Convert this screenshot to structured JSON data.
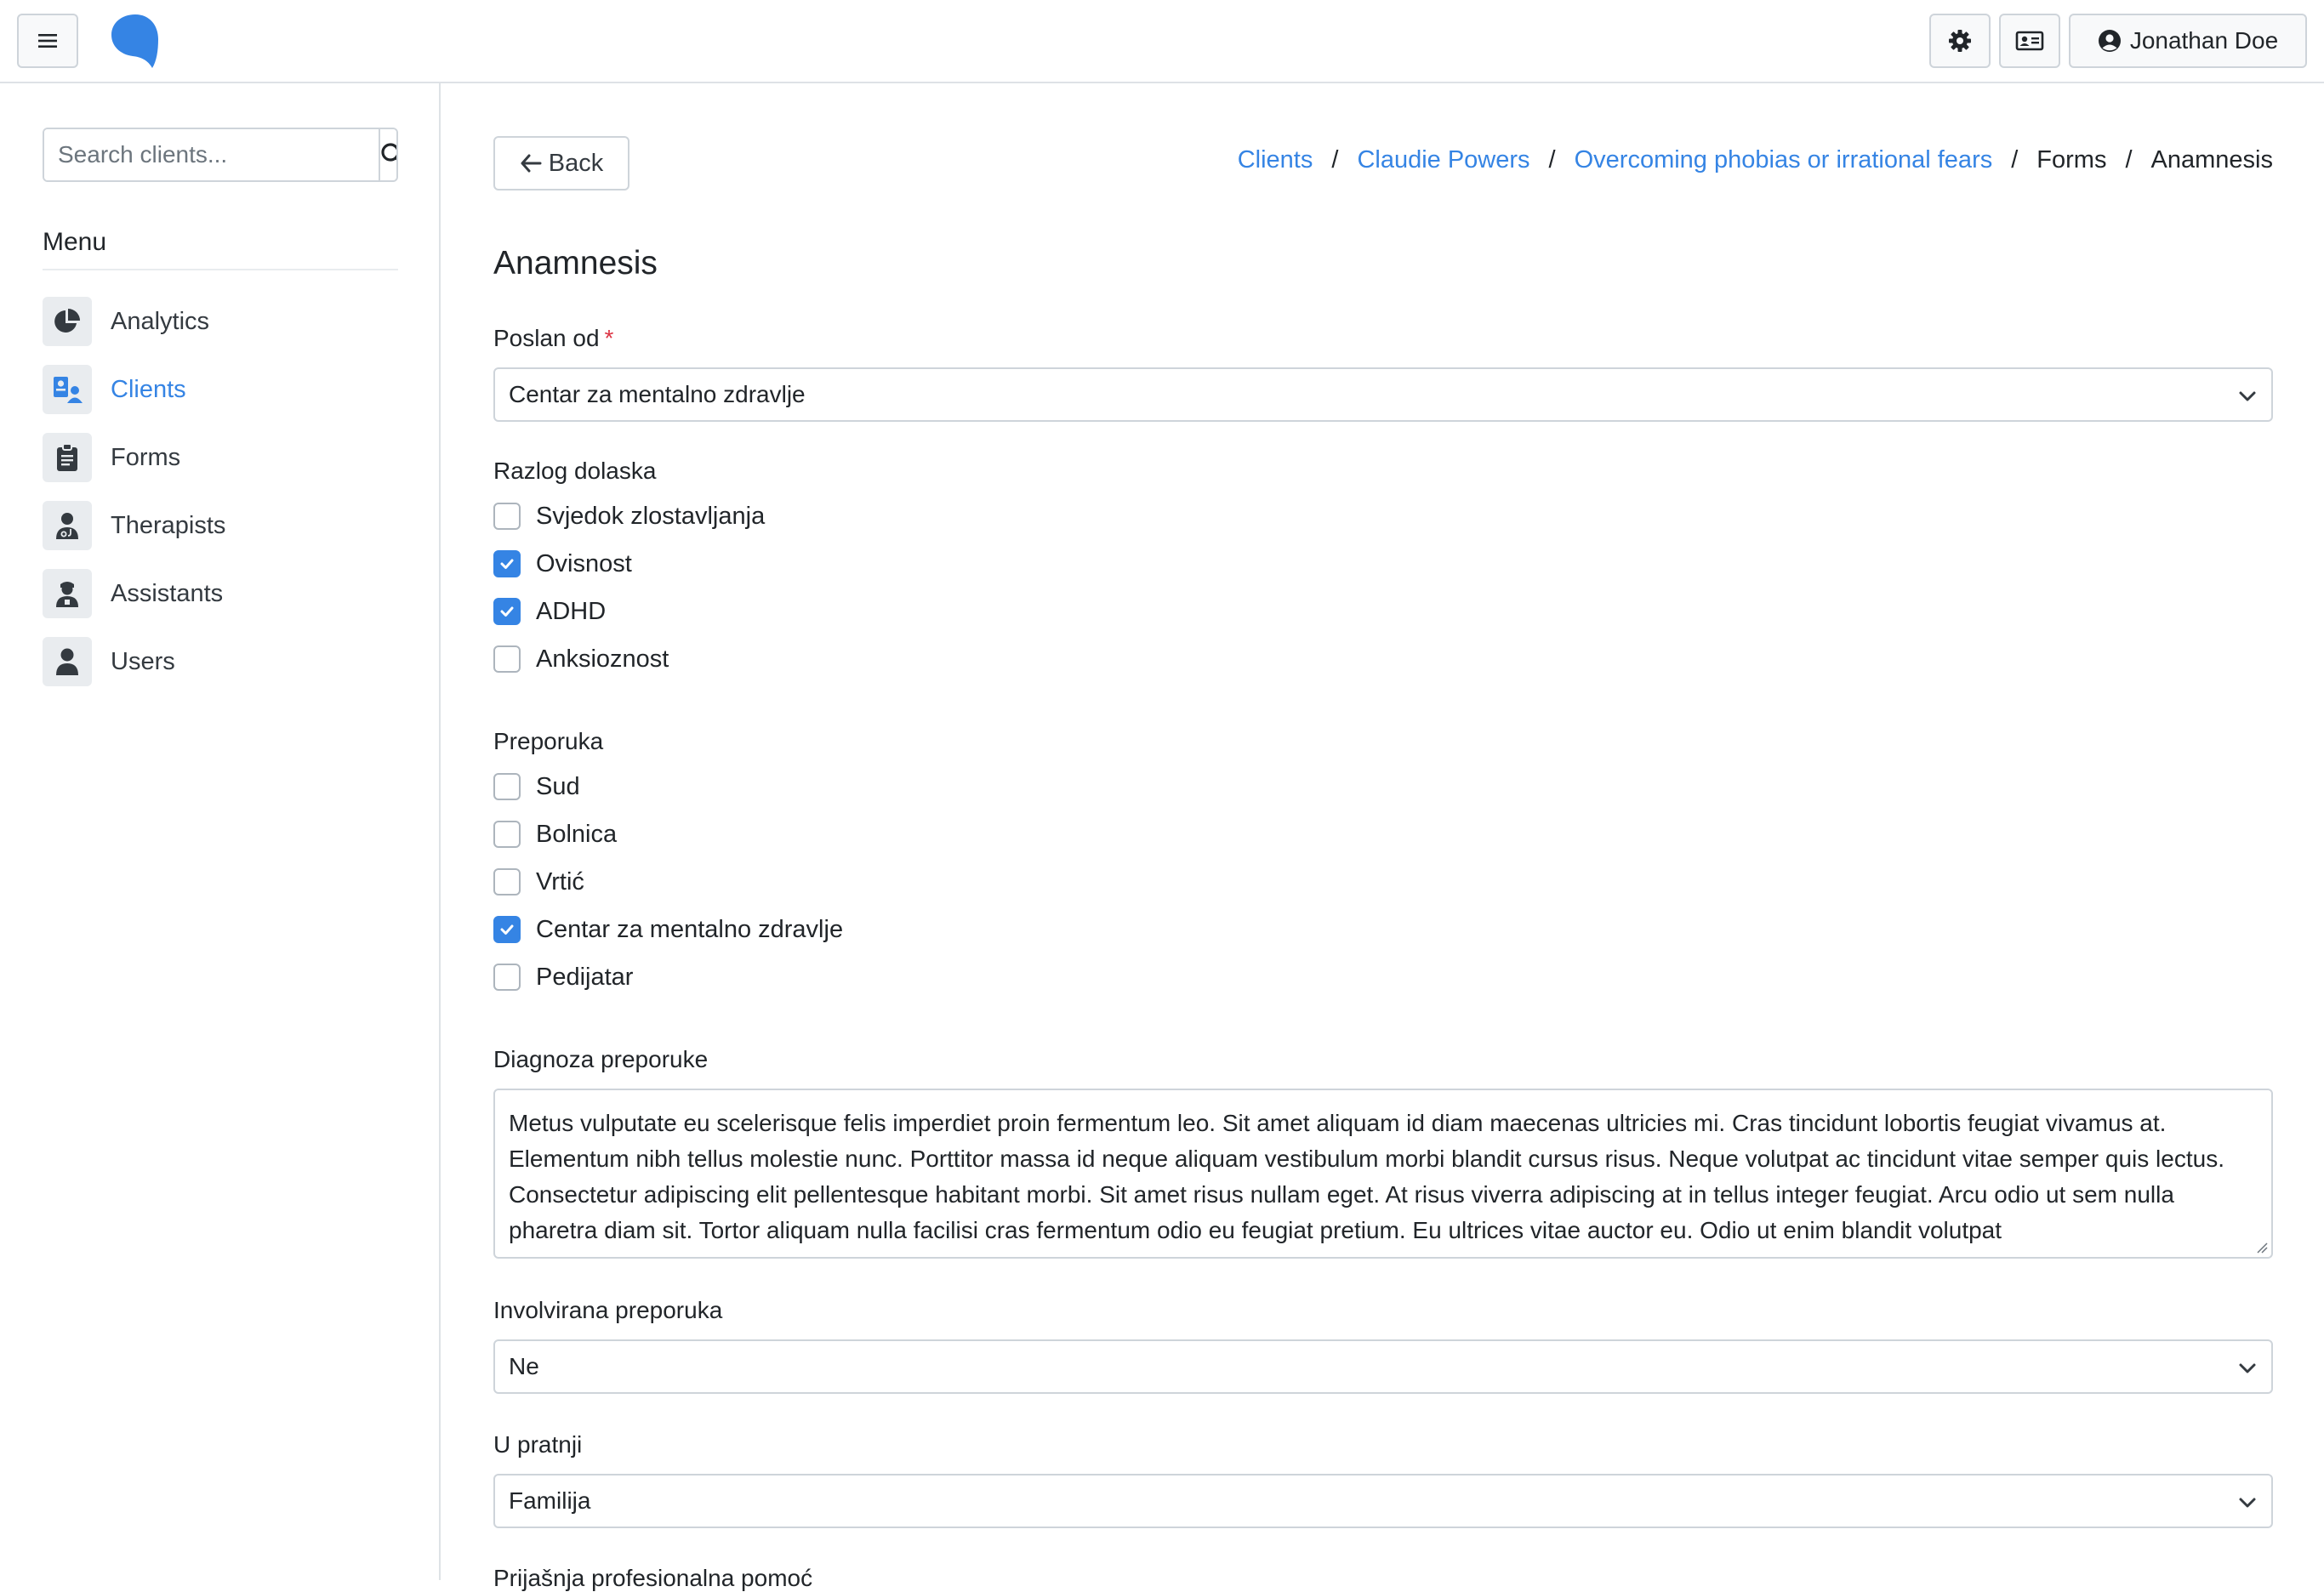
{
  "header": {
    "theme_icon": "gear-icon",
    "id_card_icon": "id-card-icon",
    "user_name": "Jonathan Doe"
  },
  "sidebar": {
    "search_placeholder": "Search clients...",
    "menu_title": "Menu",
    "items": [
      {
        "label": "Analytics",
        "icon": "pie-chart-icon"
      },
      {
        "label": "Clients",
        "icon": "clients-icon"
      },
      {
        "label": "Forms",
        "icon": "clipboard-icon"
      },
      {
        "label": "Therapists",
        "icon": "therapist-icon"
      },
      {
        "label": "Assistants",
        "icon": "assistant-icon"
      },
      {
        "label": "Users",
        "icon": "user-icon"
      }
    ]
  },
  "toolbar": {
    "back_label": "Back"
  },
  "breadcrumb": [
    "Clients",
    "Claudie Powers",
    "Overcoming phobias or irrational fears",
    "Forms",
    "Anamnesis"
  ],
  "page": {
    "title": "Anamnesis"
  },
  "form": {
    "poslan_od": {
      "label": "Poslan od",
      "required_mark": "*",
      "value": "Centar za mentalno zdravlje"
    },
    "razlog_dolaska": {
      "label": "Razlog dolaska",
      "options": [
        {
          "label": "Svjedok zlostavljanja",
          "checked": false
        },
        {
          "label": "Ovisnost",
          "checked": true
        },
        {
          "label": "ADHD",
          "checked": true
        },
        {
          "label": "Anksioznost",
          "checked": false
        }
      ]
    },
    "preporuka": {
      "label": "Preporuka",
      "options": [
        {
          "label": "Sud",
          "checked": false
        },
        {
          "label": "Bolnica",
          "checked": false
        },
        {
          "label": "Vrtić",
          "checked": false
        },
        {
          "label": "Centar za mentalno zdravlje",
          "checked": true
        },
        {
          "label": "Pedijatar",
          "checked": false
        }
      ]
    },
    "diagnoza_preporuke": {
      "label": "Diagnoza preporuke",
      "value": "Metus vulputate eu scelerisque felis imperdiet proin fermentum leo. Sit amet aliquam id diam maecenas ultricies mi. Cras tincidunt lobortis feugiat vivamus at. Elementum nibh tellus molestie nunc. Porttitor massa id neque aliquam vestibulum morbi blandit cursus risus. Neque volutpat ac tincidunt vitae semper quis lectus. Consectetur adipiscing elit pellentesque habitant morbi. Sit amet risus nullam eget. At risus viverra adipiscing at in tellus integer feugiat. Arcu odio ut sem nulla pharetra diam sit. Tortor aliquam nulla facilisi cras fermentum odio eu feugiat pretium. Eu ultrices vitae auctor eu. Odio ut enim blandit volutpat"
    },
    "involvirana_preporuka": {
      "label": "Involvirana preporuka",
      "value": "Ne"
    },
    "u_pratnji": {
      "label": "U pratnji",
      "value": "Familija"
    },
    "next_label": "Prijašnja profesionalna pomoć"
  },
  "colors": {
    "accent": "#3584e4",
    "text": "#212529",
    "border": "#ced4da",
    "required": "#dc3545"
  }
}
